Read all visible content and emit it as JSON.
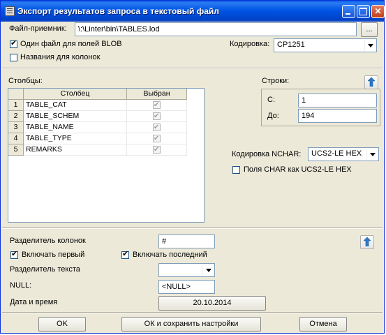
{
  "window": {
    "title": "Экспорт результатов запроса в текстовый файл"
  },
  "file": {
    "label": "Файл-приемник:",
    "value": "\\:\\Linter\\bin\\TABLES.lod",
    "browse_label": "...",
    "one_file_blob_label": "Один файл для полей BLOB",
    "one_file_blob_checked": true,
    "column_names_label": "Названия для колонок",
    "column_names_checked": false,
    "encoding_label": "Кодировка:",
    "encoding_value": "CP1251"
  },
  "columns": {
    "label": "Столбцы:",
    "headers": [
      "Столбец",
      "Выбран"
    ],
    "rows": [
      {
        "num": "1",
        "name": "TABLE_CAT",
        "selected": true
      },
      {
        "num": "2",
        "name": "TABLE_SCHEM",
        "selected": true
      },
      {
        "num": "3",
        "name": "TABLE_NAME",
        "selected": true
      },
      {
        "num": "4",
        "name": "TABLE_TYPE",
        "selected": true
      },
      {
        "num": "5",
        "name": "REMARKS",
        "selected": true
      }
    ]
  },
  "rows_range": {
    "label": "Строки:",
    "from_label": "С:",
    "from_value": "1",
    "to_label": "До:",
    "to_value": "194"
  },
  "nchar": {
    "label": "Кодировка NCHAR:",
    "value": "UCS2-LE HEX",
    "char_as_ucs2_label": "Поля CHAR как UCS2-LE HEX",
    "char_as_ucs2_checked": false
  },
  "format": {
    "col_separator_label": "Разделитель колонок",
    "col_separator_value": "#",
    "include_first_label": "Включать первый",
    "include_first_checked": true,
    "include_last_label": "Включать последний",
    "include_last_checked": true,
    "text_separator_label": "Разделитель текста",
    "text_separator_value": "",
    "null_label": "NULL:",
    "null_value": "<NULL>",
    "datetime_label": "Дата и время",
    "datetime_value": "20.10.2014"
  },
  "buttons": {
    "ok": "OK",
    "ok_save": "ОК и сохранить настройки",
    "cancel": "Отмена"
  },
  "colors": {
    "titlebar": "#0055e5",
    "dialog_bg": "#ece9d8",
    "field_border": "#7f9db9"
  }
}
